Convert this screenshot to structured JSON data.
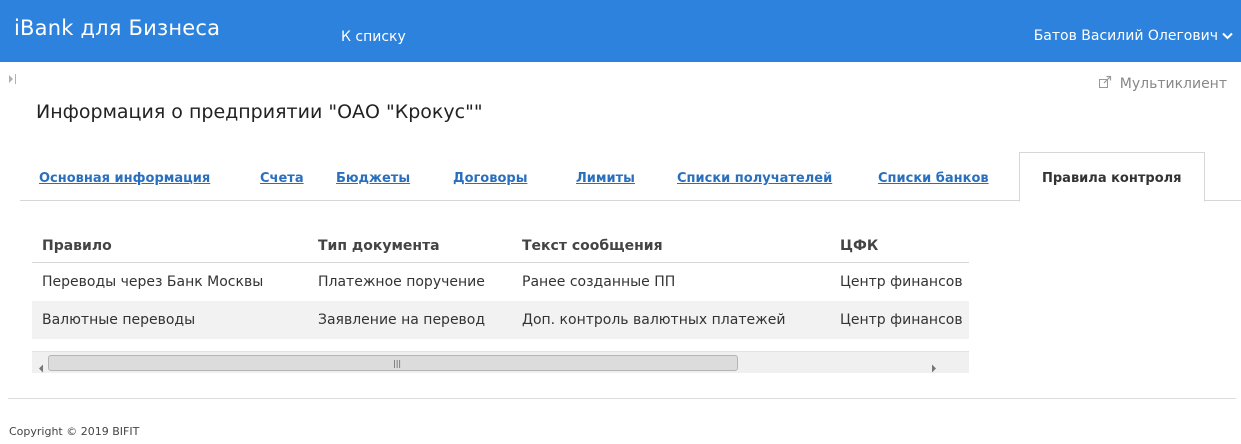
{
  "header": {
    "brand": "iBank для Бизнеса",
    "to_list": "К списку",
    "user_name": "Батов Василий Олегович"
  },
  "multiclient_label": "Мультиклиент",
  "page_title": "Информация о предприятии \"ОАО \"Крокус\"\"",
  "tabs": [
    {
      "label": "Основная информация"
    },
    {
      "label": "Счета"
    },
    {
      "label": "Бюджеты"
    },
    {
      "label": "Договоры"
    },
    {
      "label": "Лимиты"
    },
    {
      "label": "Списки получателей"
    },
    {
      "label": "Списки банков"
    },
    {
      "label": "Правила контроля"
    }
  ],
  "active_tab": "Правила контроля",
  "table": {
    "columns": [
      "Правило",
      "Тип документа",
      "Текст сообщения",
      "ЦФК"
    ],
    "rows": [
      [
        "Переводы через Банк Москвы",
        "Платежное поручение",
        "Ранее созданные ПП",
        "Центр финансов"
      ],
      [
        "Валютные переводы",
        "Заявление на перевод",
        "Доп. контроль валютных платежей",
        "Центр финансов"
      ]
    ]
  },
  "footer": {
    "copyright": "Copyright © 2019 BIFIT"
  },
  "colors": {
    "header_bg": "#2c82dd",
    "link": "#2a6fbe",
    "alt_row": "#f2f2f2"
  },
  "icons": {
    "user_menu": "chevron-down-icon",
    "multiclient": "external-window-icon",
    "sidebar_toggle": "panel-expand-icon"
  }
}
